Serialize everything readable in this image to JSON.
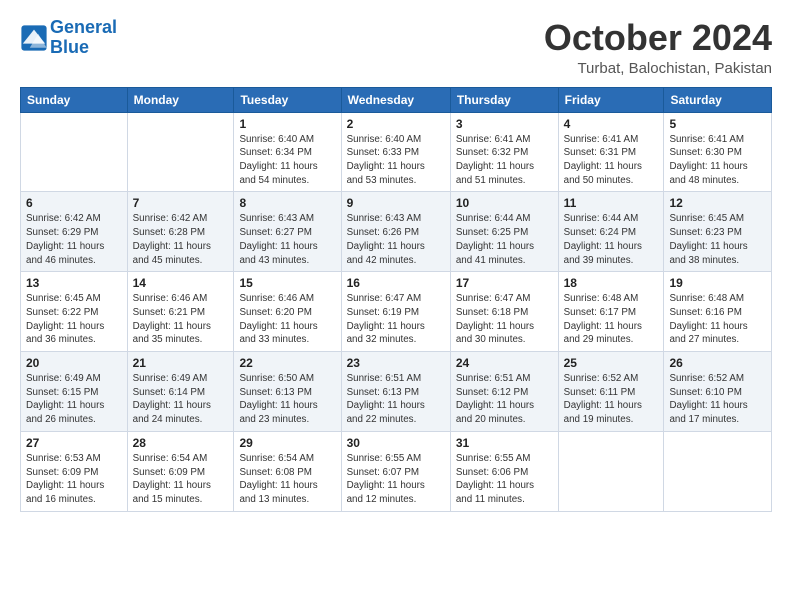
{
  "logo": {
    "line1": "General",
    "line2": "Blue"
  },
  "header": {
    "month": "October 2024",
    "location": "Turbat, Balochistan, Pakistan"
  },
  "weekdays": [
    "Sunday",
    "Monday",
    "Tuesday",
    "Wednesday",
    "Thursday",
    "Friday",
    "Saturday"
  ],
  "weeks": [
    [
      {
        "day": "",
        "info": ""
      },
      {
        "day": "",
        "info": ""
      },
      {
        "day": "1",
        "info": "Sunrise: 6:40 AM\nSunset: 6:34 PM\nDaylight: 11 hours\nand 54 minutes."
      },
      {
        "day": "2",
        "info": "Sunrise: 6:40 AM\nSunset: 6:33 PM\nDaylight: 11 hours\nand 53 minutes."
      },
      {
        "day": "3",
        "info": "Sunrise: 6:41 AM\nSunset: 6:32 PM\nDaylight: 11 hours\nand 51 minutes."
      },
      {
        "day": "4",
        "info": "Sunrise: 6:41 AM\nSunset: 6:31 PM\nDaylight: 11 hours\nand 50 minutes."
      },
      {
        "day": "5",
        "info": "Sunrise: 6:41 AM\nSunset: 6:30 PM\nDaylight: 11 hours\nand 48 minutes."
      }
    ],
    [
      {
        "day": "6",
        "info": "Sunrise: 6:42 AM\nSunset: 6:29 PM\nDaylight: 11 hours\nand 46 minutes."
      },
      {
        "day": "7",
        "info": "Sunrise: 6:42 AM\nSunset: 6:28 PM\nDaylight: 11 hours\nand 45 minutes."
      },
      {
        "day": "8",
        "info": "Sunrise: 6:43 AM\nSunset: 6:27 PM\nDaylight: 11 hours\nand 43 minutes."
      },
      {
        "day": "9",
        "info": "Sunrise: 6:43 AM\nSunset: 6:26 PM\nDaylight: 11 hours\nand 42 minutes."
      },
      {
        "day": "10",
        "info": "Sunrise: 6:44 AM\nSunset: 6:25 PM\nDaylight: 11 hours\nand 41 minutes."
      },
      {
        "day": "11",
        "info": "Sunrise: 6:44 AM\nSunset: 6:24 PM\nDaylight: 11 hours\nand 39 minutes."
      },
      {
        "day": "12",
        "info": "Sunrise: 6:45 AM\nSunset: 6:23 PM\nDaylight: 11 hours\nand 38 minutes."
      }
    ],
    [
      {
        "day": "13",
        "info": "Sunrise: 6:45 AM\nSunset: 6:22 PM\nDaylight: 11 hours\nand 36 minutes."
      },
      {
        "day": "14",
        "info": "Sunrise: 6:46 AM\nSunset: 6:21 PM\nDaylight: 11 hours\nand 35 minutes."
      },
      {
        "day": "15",
        "info": "Sunrise: 6:46 AM\nSunset: 6:20 PM\nDaylight: 11 hours\nand 33 minutes."
      },
      {
        "day": "16",
        "info": "Sunrise: 6:47 AM\nSunset: 6:19 PM\nDaylight: 11 hours\nand 32 minutes."
      },
      {
        "day": "17",
        "info": "Sunrise: 6:47 AM\nSunset: 6:18 PM\nDaylight: 11 hours\nand 30 minutes."
      },
      {
        "day": "18",
        "info": "Sunrise: 6:48 AM\nSunset: 6:17 PM\nDaylight: 11 hours\nand 29 minutes."
      },
      {
        "day": "19",
        "info": "Sunrise: 6:48 AM\nSunset: 6:16 PM\nDaylight: 11 hours\nand 27 minutes."
      }
    ],
    [
      {
        "day": "20",
        "info": "Sunrise: 6:49 AM\nSunset: 6:15 PM\nDaylight: 11 hours\nand 26 minutes."
      },
      {
        "day": "21",
        "info": "Sunrise: 6:49 AM\nSunset: 6:14 PM\nDaylight: 11 hours\nand 24 minutes."
      },
      {
        "day": "22",
        "info": "Sunrise: 6:50 AM\nSunset: 6:13 PM\nDaylight: 11 hours\nand 23 minutes."
      },
      {
        "day": "23",
        "info": "Sunrise: 6:51 AM\nSunset: 6:13 PM\nDaylight: 11 hours\nand 22 minutes."
      },
      {
        "day": "24",
        "info": "Sunrise: 6:51 AM\nSunset: 6:12 PM\nDaylight: 11 hours\nand 20 minutes."
      },
      {
        "day": "25",
        "info": "Sunrise: 6:52 AM\nSunset: 6:11 PM\nDaylight: 11 hours\nand 19 minutes."
      },
      {
        "day": "26",
        "info": "Sunrise: 6:52 AM\nSunset: 6:10 PM\nDaylight: 11 hours\nand 17 minutes."
      }
    ],
    [
      {
        "day": "27",
        "info": "Sunrise: 6:53 AM\nSunset: 6:09 PM\nDaylight: 11 hours\nand 16 minutes."
      },
      {
        "day": "28",
        "info": "Sunrise: 6:54 AM\nSunset: 6:09 PM\nDaylight: 11 hours\nand 15 minutes."
      },
      {
        "day": "29",
        "info": "Sunrise: 6:54 AM\nSunset: 6:08 PM\nDaylight: 11 hours\nand 13 minutes."
      },
      {
        "day": "30",
        "info": "Sunrise: 6:55 AM\nSunset: 6:07 PM\nDaylight: 11 hours\nand 12 minutes."
      },
      {
        "day": "31",
        "info": "Sunrise: 6:55 AM\nSunset: 6:06 PM\nDaylight: 11 hours\nand 11 minutes."
      },
      {
        "day": "",
        "info": ""
      },
      {
        "day": "",
        "info": ""
      }
    ]
  ]
}
